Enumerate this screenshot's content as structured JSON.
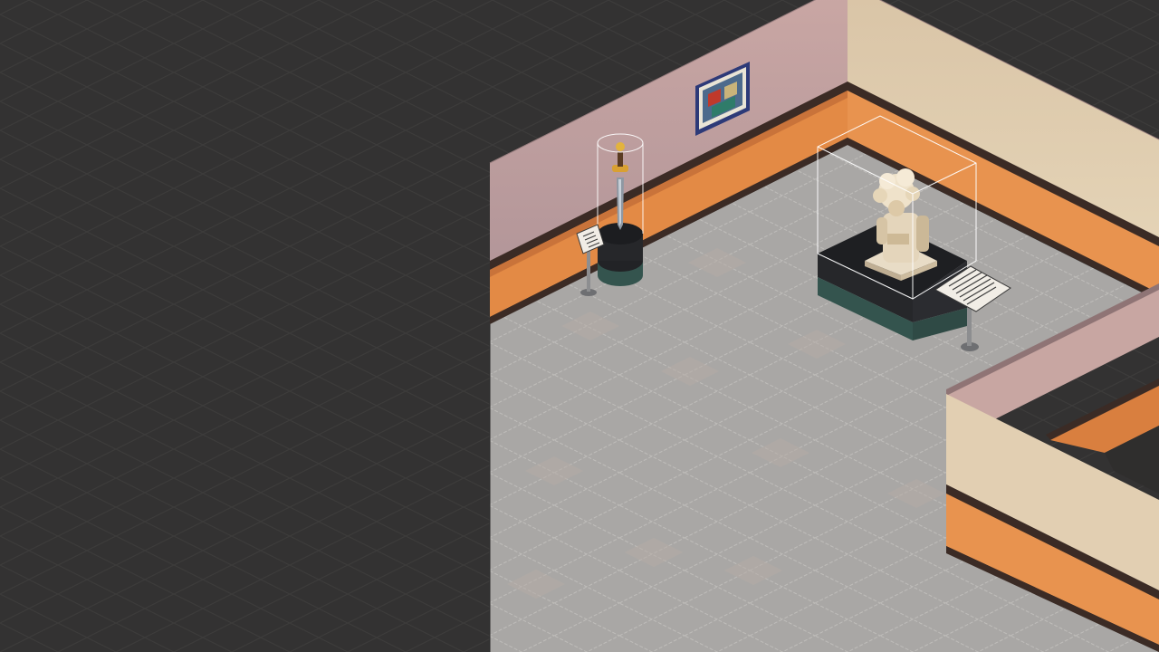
{
  "scene": {
    "name": "isometric-museum-room",
    "palette": {
      "void": "#333232",
      "void_grid": "#3b3a39",
      "floor": "#a9a7a5",
      "floor_grid": "#c2c0bd",
      "floor_tile_tint": "#b3a9a2",
      "wall_top_pink": "#b79a9c",
      "wall_upper_cream": "#ddc9a8",
      "wall_trim_dark": "#3b2b25",
      "wall_band_orange": "#e38a45",
      "wall_band_orange_shadow": "#bc6a34",
      "pedestal_dark": "#26272a",
      "pedestal_teal": "#34544e",
      "plaque_paper": "#f1ede6",
      "stand_metal": "#8d8e90",
      "glass_outline": "#ffffff"
    },
    "exhibits": [
      {
        "id": "sword-display",
        "icon": "sword-icon",
        "kind": "sword in glass cylinder"
      },
      {
        "id": "statue-display",
        "icon": "statue-icon",
        "kind": "statue in glass case"
      },
      {
        "id": "wall-painting",
        "icon": "painting-icon",
        "kind": "framed painting"
      }
    ],
    "placards": [
      {
        "id": "sword-placard",
        "icon": "placard-icon"
      },
      {
        "id": "statue-placard",
        "icon": "placard-icon"
      }
    ]
  }
}
